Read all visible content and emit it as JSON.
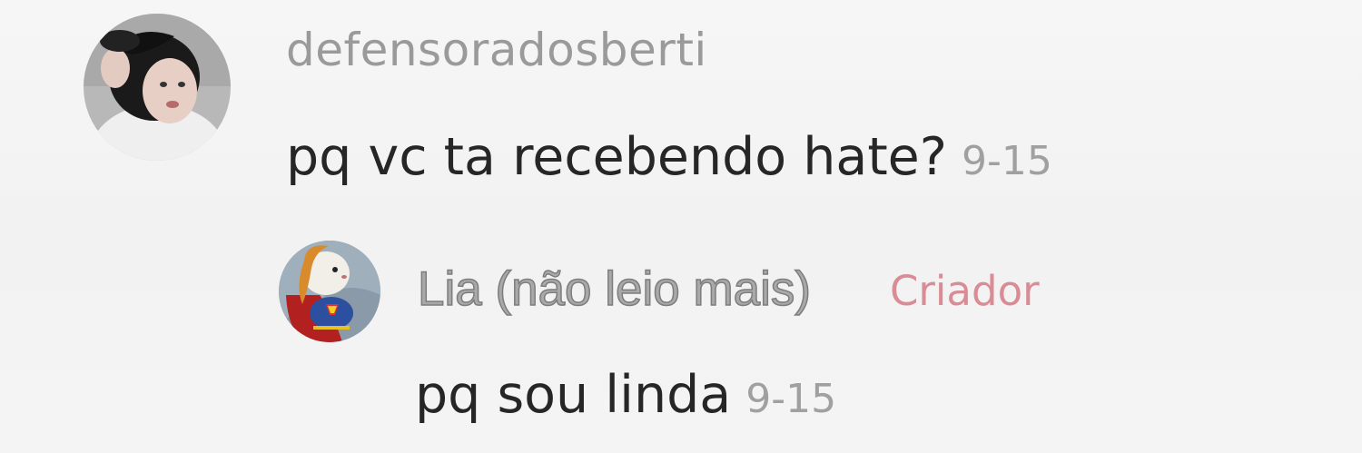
{
  "comment": {
    "username": "defensoradosberti",
    "text": "pq vc ta recebendo hate?",
    "date": "9-15",
    "avatar_icon": "user-avatar-photo"
  },
  "reply": {
    "username": "Lia (não leio mais)",
    "badge": "Criador",
    "text": "pq sou linda",
    "date": "9-15",
    "avatar_icon": "hamster-supergirl-avatar"
  },
  "colors": {
    "background": "#f4f4f4",
    "text_primary": "#262626",
    "text_secondary": "#9a9a9a",
    "creator_badge": "#d98c95"
  }
}
